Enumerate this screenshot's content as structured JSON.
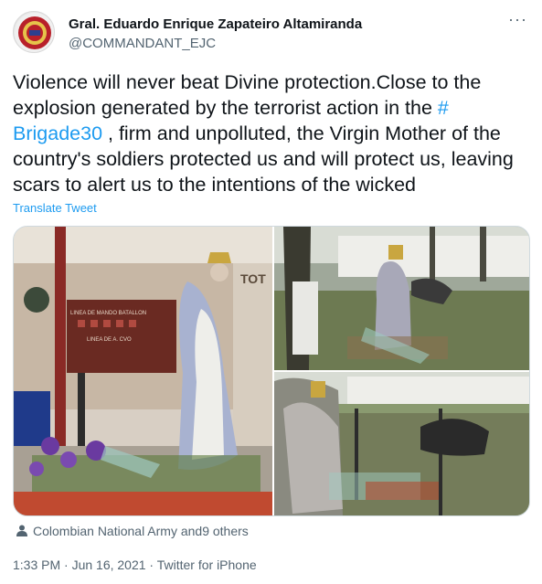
{
  "author": {
    "name": "Gral. Eduardo Enrique Zapateiro Altamiranda",
    "handle": "@COMMANDANT_EJC"
  },
  "menu": {
    "more_label": "···"
  },
  "tweet": {
    "text_before": "Violence will never beat Divine protection.Close to the explosion generated by the terrorist action in the ",
    "hashtag": "# Brigade30",
    "text_after": " , firm and unpolluted, the Virgin Mother of the country's soldiers protected us and will protect us, leaving scars to alert us to the intentions of the wicked"
  },
  "translate": {
    "label": "Translate Tweet"
  },
  "media": {
    "photos": [
      {
        "description_icon": "statue-photo-icon"
      },
      {
        "description_icon": "statue-explosion-photo-icon"
      },
      {
        "description_icon": "explosion-debris-photo-icon"
      }
    ],
    "sign_text": "LINEA DE MANDO BATALLON",
    "sign_text_2": "LINEA DE A. CVO",
    "wall_text": "TOT"
  },
  "social": {
    "label": "Colombian National Army and9 others"
  },
  "meta": {
    "text": "1:33 PM · Jun 16, 2021 · Twitter for iPhone"
  },
  "colors": {
    "link": "#1d9bf0",
    "secondary": "#536471",
    "text": "#0f1419"
  }
}
